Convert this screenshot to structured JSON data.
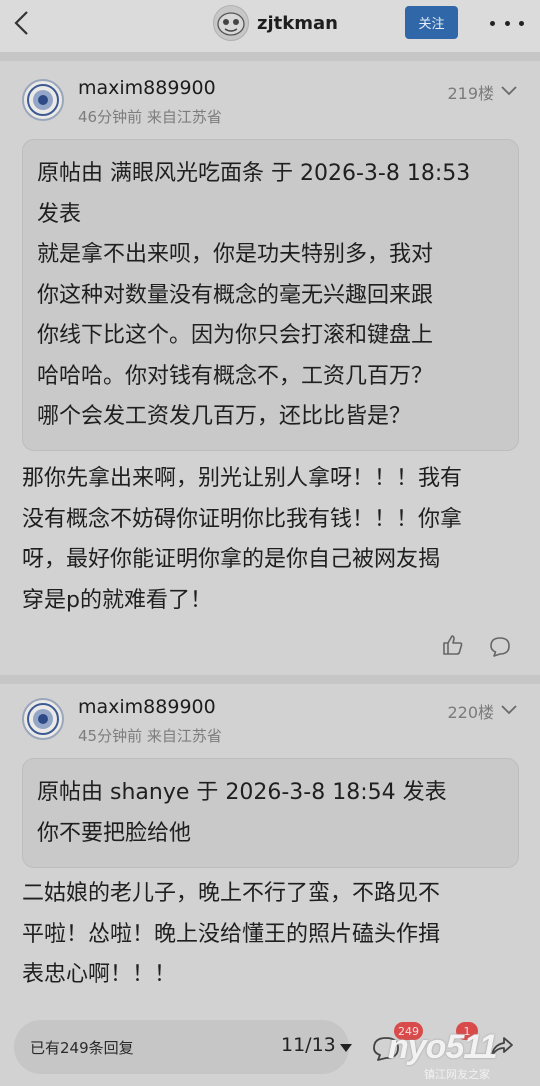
{
  "header": {
    "author_name": "zjtkman",
    "follow_label": "关注"
  },
  "posts": [
    {
      "username": "maxim889900",
      "meta": "46分钟前 来自江苏省",
      "floor": "219楼",
      "quote_lines": [
        "原帖由 满眼风光吃面条 于 2026-3-8 18:53",
        "发表",
        "就是拿不出来呗，你是功夫特别多，我对",
        "你这种对数量没有概念的毫无兴趣回来跟",
        "你线下比这个。因为你只会打滚和键盘上",
        "哈哈哈。你对钱有概念不，工资几百万？",
        "哪个会发工资发几百万，还比比皆是？"
      ],
      "body_lines": [
        "那你先拿出来啊，别光让别人拿呀！！！我有",
        "没有概念不妨碍你证明你比我有钱！！！你拿",
        "呀，最好你能证明你拿的是你自己被网友揭",
        "穿是p的就难看了！"
      ]
    },
    {
      "username": "maxim889900",
      "meta": "45分钟前 来自江苏省",
      "floor": "220楼",
      "quote_lines": [
        "原帖由 shanye 于 2026-3-8 18:54 发表",
        "你不要把脸给他"
      ],
      "body_lines": [
        "二姑娘的老儿子，晚上不行了蛮，不路见不",
        "平啦！怂啦！晚上没给懂王的照片磕头作揖",
        "表忠心啊！！！"
      ]
    }
  ],
  "footer": {
    "reply_count_text": "已有249条回复",
    "page_indicator": "11/13",
    "comment_badge": "249",
    "notify_badge": "1",
    "watermark": "nyo511",
    "watermark_sub": "镇江网友之家"
  },
  "icons": [
    "back-icon",
    "avatar-icon",
    "more-icon",
    "chevron-down-icon",
    "like-icon",
    "comment-icon",
    "share-icon"
  ]
}
